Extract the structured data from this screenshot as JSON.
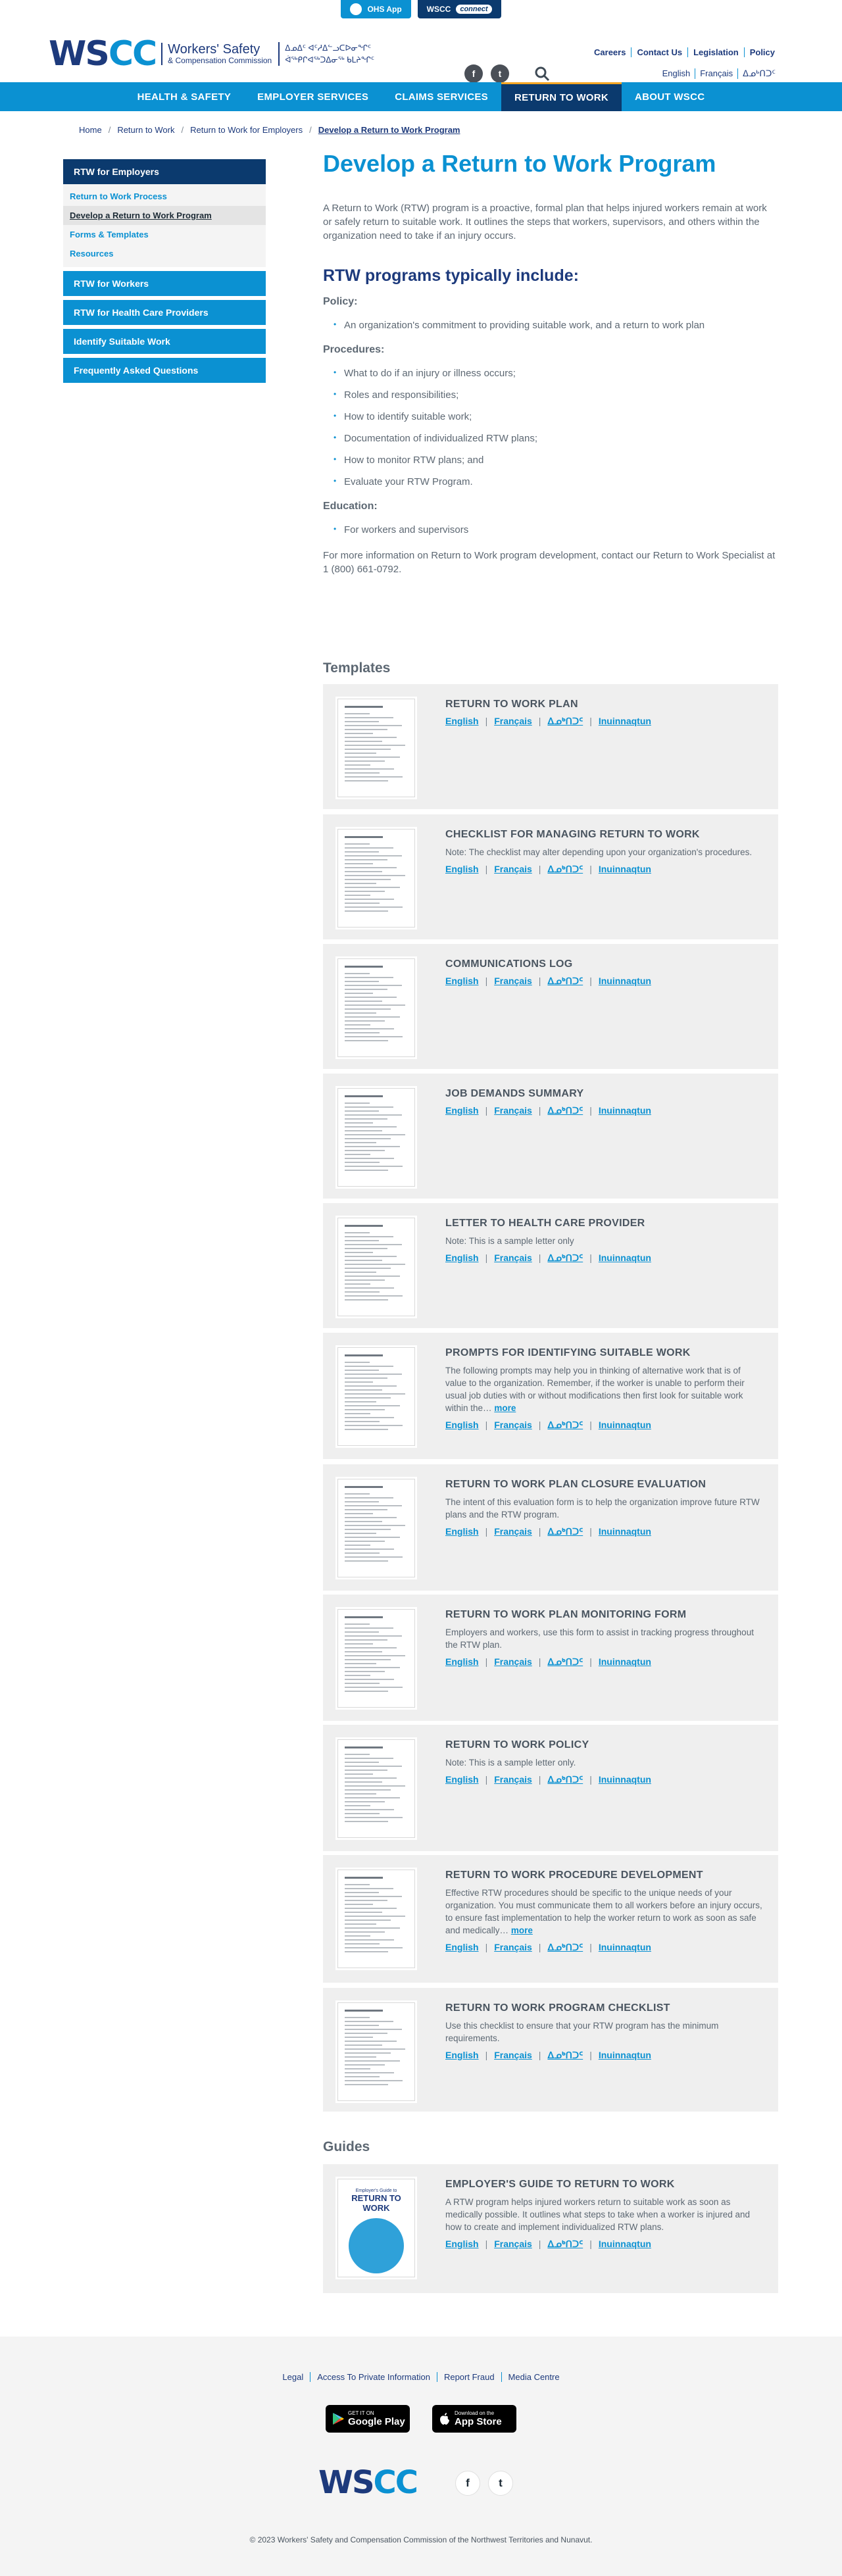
{
  "topbar": {
    "ohs_app": "OHS App",
    "wscc": "WSCC",
    "connect": "connect"
  },
  "header": {
    "logo_wscc_1": "WS",
    "logo_wscc_2": "CC",
    "org_name_line1": "Workers' Safety",
    "org_name_line2": "& Compensation Commission",
    "syllabics_line1": "ᐃᓄᐃᑦ ᐊᑦᓱᐃᓪᓗᑕᐅᓂᖏᑦ",
    "syllabics_line2": "ᐋᖅᑭᒋᐊᖅᑐᐃᓂᖅ ᑲᒪᔨᖏᑦ",
    "utility_links": [
      "Careers",
      "Contact Us",
      "Legislation",
      "Policy"
    ],
    "languages": [
      "English",
      "Français",
      "ᐃᓄᒃᑎᑐᑦ"
    ],
    "social": [
      "f",
      "t"
    ]
  },
  "nav": {
    "items": [
      "HEALTH & SAFETY",
      "EMPLOYER SERVICES",
      "CLAIMS SERVICES",
      "RETURN TO WORK",
      "ABOUT WSCC"
    ],
    "active": "RETURN TO WORK"
  },
  "breadcrumb": [
    "Home",
    "Return to Work",
    "Return to Work for Employers",
    "Develop a Return to Work Program"
  ],
  "sidebar": {
    "header": "RTW for Employers",
    "sub_items": [
      "Return to Work Process",
      "Develop a Return to Work Program",
      "Forms & Templates",
      "Resources"
    ],
    "selected": "Develop a Return to Work Program",
    "sections": [
      "RTW for Workers",
      "RTW for Health Care Providers",
      "Identify Suitable Work",
      "Frequently Asked Questions"
    ]
  },
  "main": {
    "title": "Develop a Return to Work Program",
    "intro": "A Return to Work (RTW) program is a proactive, formal plan that helps injured workers remain at work or safely return to suitable work. It outlines the steps that workers, supervisors, and others within the organization need to take if an injury occurs.",
    "programs_heading": "RTW programs typically include:",
    "policy_heading": "Policy:",
    "policy_items": [
      "An organization's commitment to providing suitable work, and a return to work plan"
    ],
    "procedures_heading": "Procedures:",
    "procedures_items": [
      "What to do if an injury or illness occurs;",
      "Roles and responsibilities;",
      "How to identify suitable work;",
      "Documentation of individualized RTW plans;",
      "How to monitor RTW plans; and",
      "Evaluate your RTW Program."
    ],
    "education_heading": "Education:",
    "education_items": [
      "For workers and supervisors"
    ],
    "more_info": "For more information on Return to Work program development, contact our Return to Work Specialist at 1 (800) 661-0792."
  },
  "templates_heading": "Templates",
  "guides_heading": "Guides",
  "link_labels": [
    "English",
    "Français",
    "ᐃᓄᒃᑎᑐᑦ",
    "Inuinnaqtun"
  ],
  "more_label": "more",
  "templates": [
    {
      "title": "RETURN TO WORK PLAN",
      "desc": ""
    },
    {
      "title": "CHECKLIST FOR MANAGING RETURN TO WORK",
      "desc": "Note: The checklist may alter depending upon your organization's procedures."
    },
    {
      "title": "COMMUNICATIONS LOG",
      "desc": ""
    },
    {
      "title": "JOB DEMANDS SUMMARY",
      "desc": ""
    },
    {
      "title": "LETTER TO HEALTH CARE PROVIDER",
      "desc": "Note: This is a sample letter only"
    },
    {
      "title": "PROMPTS FOR IDENTIFYING SUITABLE WORK",
      "desc": "The following prompts may help you in thinking of alternative work that is of value to the organization. Remember, if the worker is unable to perform their usual job duties with or without modifications then first look for suitable work within the…"
    },
    {
      "title": "RETURN TO WORK PLAN CLOSURE EVALUATION",
      "desc": "The intent of this evaluation form is to help the organization improve future RTW plans and the RTW program."
    },
    {
      "title": "RETURN TO WORK PLAN MONITORING FORM",
      "desc": "Employers and workers, use this form to assist in tracking progress throughout the RTW plan."
    },
    {
      "title": "RETURN TO WORK POLICY",
      "desc": "Note: This is a sample letter only."
    },
    {
      "title": "RETURN TO WORK PROCEDURE DEVELOPMENT",
      "desc": "Effective RTW procedures should be specific to the unique needs of your organization. You must communicate them to all workers before an injury occurs, to ensure fast implementation to help the worker return to work as soon as safe and medically…"
    },
    {
      "title": "RETURN TO WORK PROGRAM CHECKLIST",
      "desc": "Use this checklist to ensure that your RTW program has the minimum requirements."
    }
  ],
  "guides": [
    {
      "title": "EMPLOYER'S GUIDE TO RETURN TO WORK",
      "desc": "A RTW program helps injured workers return to suitable work as soon as medically possible. It outlines what steps to take when a worker is injured and how to create and implement individualized RTW plans.",
      "thumb_top": "Employer's Guide to",
      "thumb_title": "RETURN TO WORK"
    }
  ],
  "footer": {
    "links": [
      "Legal",
      "Access To Private Information",
      "Report Fraud",
      "Media Centre"
    ],
    "google_small": "GET IT ON",
    "google_big": "Google Play",
    "apple_small": "Download on the",
    "apple_big": "App Store",
    "copyright": "© 2023 Workers' Safety and Compensation Commission of the Northwest Territories and Nunavut."
  },
  "colors": {
    "accent": "#0b91d2",
    "navy": "#0b3a6e",
    "brand": "#1d3a7c"
  }
}
